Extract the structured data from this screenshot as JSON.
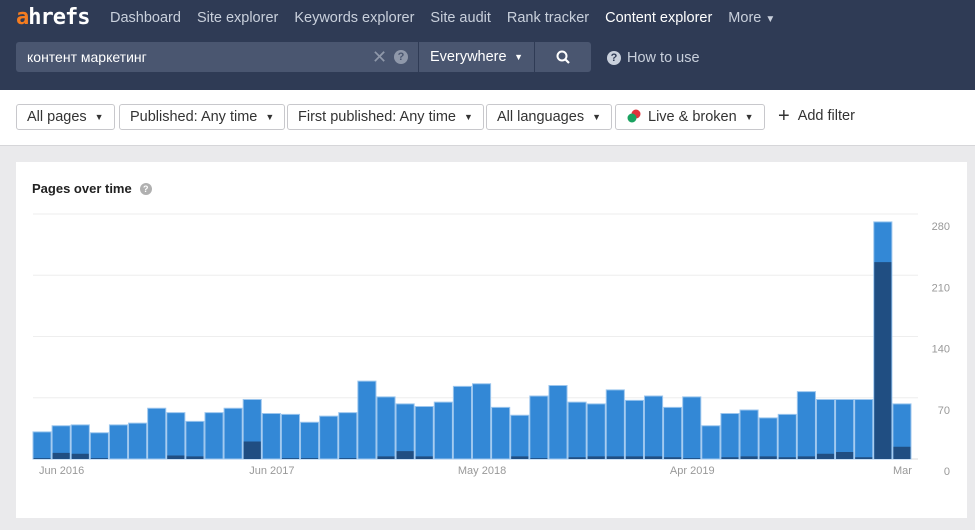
{
  "header": {
    "logo": "ahrefs",
    "nav": [
      "Dashboard",
      "Site explorer",
      "Keywords explorer",
      "Site audit",
      "Rank tracker",
      "Content explorer",
      "More"
    ],
    "active": "Content explorer",
    "search_value": "контент маркетинг",
    "scope": "Everywhere",
    "how_to_use": "How to use"
  },
  "filters": {
    "items": [
      "All pages",
      "Published: Any time",
      "First published: Any time",
      "All languages",
      "Live & broken"
    ],
    "add_filter": "Add filter"
  },
  "card": {
    "title": "Pages over time"
  },
  "chart_data": {
    "type": "bar",
    "stacked": "overlay",
    "title": "Pages over time",
    "colors": {
      "total": "#3388d6",
      "dark": "#204e82"
    },
    "x_tick_labels": [
      {
        "index": 1,
        "label": "Jun 2016"
      },
      {
        "index": 12,
        "label": "Jun 2017"
      },
      {
        "index": 23,
        "label": "May 2018"
      },
      {
        "index": 34,
        "label": "Apr 2019"
      },
      {
        "index": 45,
        "label": "Mar"
      }
    ],
    "y_ticks": [
      0,
      70,
      140,
      210,
      280
    ],
    "ylim": [
      0,
      280
    ],
    "grid": true,
    "y_axis_position": "right",
    "series": [
      {
        "values": [
          31,
          38,
          39,
          30,
          39,
          41,
          58,
          53,
          43,
          53,
          58,
          68,
          52,
          51,
          42,
          49,
          53,
          89,
          71,
          63,
          60,
          65,
          83,
          86,
          59,
          50,
          72,
          84,
          65,
          63,
          79,
          67,
          72,
          59,
          71,
          38,
          52,
          56,
          47,
          51,
          77,
          68,
          68,
          68,
          271,
          63
        ]
      },
      {
        "values": [
          1,
          7,
          6,
          1,
          0,
          0,
          0,
          4,
          3,
          0,
          0,
          20,
          0,
          1,
          1,
          0,
          1,
          0,
          3,
          9,
          3,
          0,
          0,
          0,
          0,
          3,
          1,
          0,
          2,
          3,
          3,
          3,
          3,
          2,
          1,
          0,
          2,
          3,
          3,
          2,
          3,
          6,
          8,
          2,
          225,
          14
        ]
      }
    ]
  }
}
